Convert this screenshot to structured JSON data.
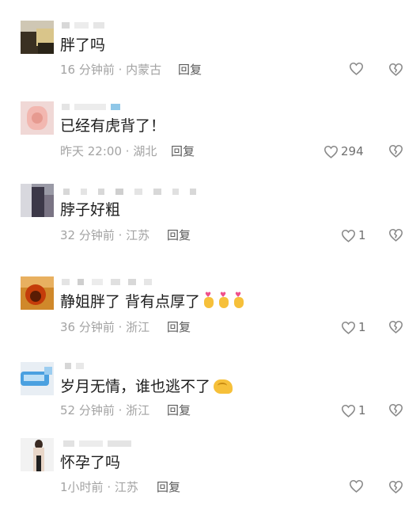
{
  "comments": [
    {
      "text": "胖了吗",
      "time": "16 分钟前",
      "location": "内蒙古",
      "reply": "回复",
      "likes": ""
    },
    {
      "text": "已经有虎背了！",
      "time": "昨天 22:00",
      "location": "湖北",
      "reply": "回复",
      "likes": "294"
    },
    {
      "text": "脖子好粗",
      "time": "32 分钟前",
      "location": "江苏",
      "reply": "回复",
      "likes": "1"
    },
    {
      "text": "静姐胖了  背有点厚了",
      "time": "36 分钟前",
      "location": "浙江",
      "reply": "回复",
      "likes": "1"
    },
    {
      "text": "岁月无情，谁也逃不了",
      "time": "52 分钟前",
      "location": "浙江",
      "reply": "回复",
      "likes": "1"
    },
    {
      "text": "怀孕了吗",
      "time": "1小时前",
      "location": "江苏",
      "reply": "回复",
      "likes": ""
    }
  ],
  "icons": {
    "like": "heart-outline-icon",
    "dislike": "broken-heart-outline-icon"
  },
  "colors": {
    "text": "#1c1c1c",
    "meta": "#a3a3a3",
    "icon": "#8a8a8a"
  }
}
